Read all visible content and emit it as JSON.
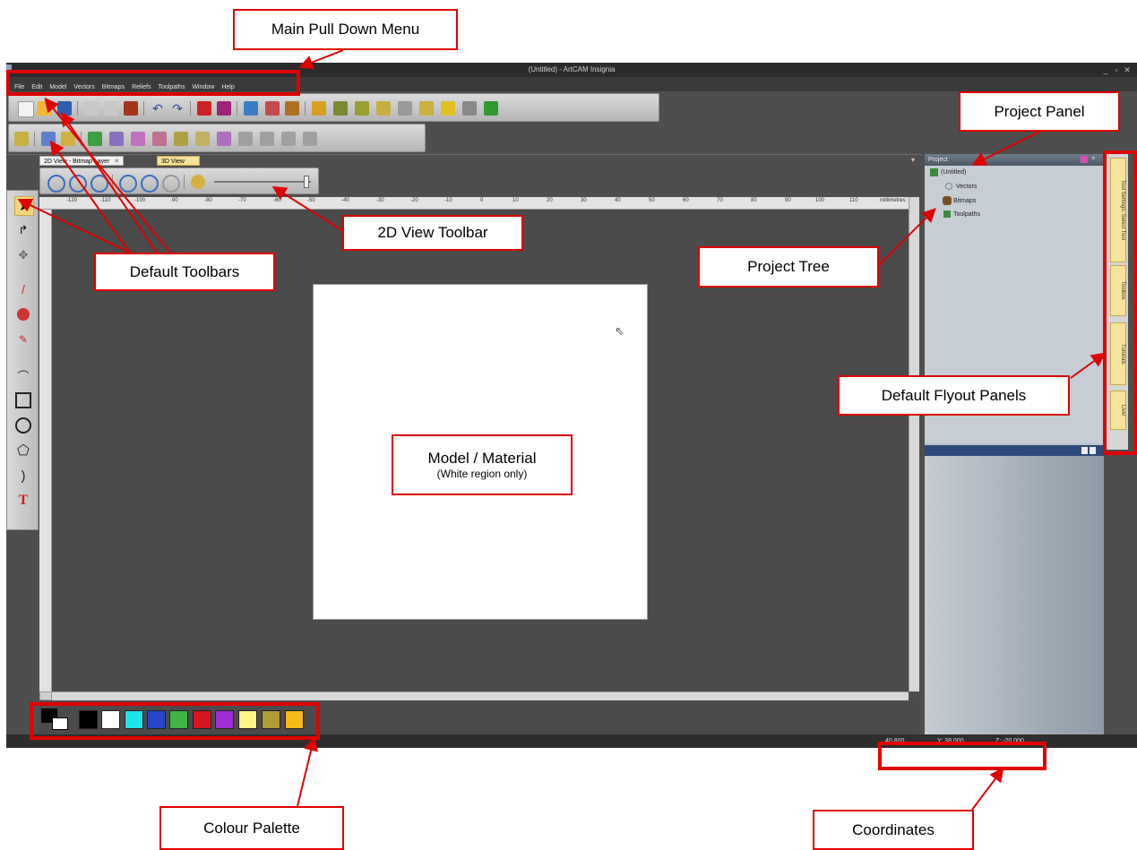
{
  "window": {
    "title": "(Untitled) - ArtCAM Insignia",
    "controls": [
      "_",
      "▫",
      "✕"
    ]
  },
  "menu": [
    "File",
    "Edit",
    "Model",
    "Vectors",
    "Bitmaps",
    "Reliefs",
    "Toolpaths",
    "Window",
    "Help"
  ],
  "view_tabs": [
    {
      "label": "2D View - Bitmap Layer",
      "close": "✕"
    },
    {
      "label": "3D View"
    }
  ],
  "ruler": {
    "ticks": [
      "-120",
      "-110",
      "-100",
      "-90",
      "-80",
      "-70",
      "-60",
      "-50",
      "-40",
      "-30",
      "-20",
      "-10",
      "0",
      "10",
      "20",
      "30",
      "40",
      "50",
      "60",
      "70",
      "80",
      "90",
      "100",
      "110"
    ],
    "unit": "millimetres"
  },
  "project": {
    "title": "Project",
    "root": "(Untitled)",
    "items": [
      "Vectors",
      "Bitmaps",
      "Toolpaths"
    ]
  },
  "flyouts": [
    "Tool Settings: Select Tool",
    "Toolbox",
    "Tutorials",
    "Live!"
  ],
  "palette": [
    "#000000",
    "#ffffff",
    "#1fe3e8",
    "#2b44c9",
    "#3fb548",
    "#d8161f",
    "#9e2ed6",
    "#fff784",
    "#b19c38",
    "#f7b81a"
  ],
  "coordinates": {
    "x": "40.800",
    "y": "Y: 38.000",
    "z": "Z: -20.000"
  },
  "callouts": {
    "main_menu": "Main Pull Down Menu",
    "project_panel": "Project Panel",
    "view_toolbar": "2D View Toolbar",
    "default_toolbars": "Default Toolbars",
    "project_tree": "Project Tree",
    "flyout_panels": "Default Flyout Panels",
    "model_material": "Model / Material",
    "model_material_note": "(White region only)",
    "colour_palette": "Colour Palette",
    "coordinates": "Coordinates"
  },
  "colors": {
    "highlight": "#e00000",
    "app_bg": "#4e4e4e",
    "material": "#ffffff"
  }
}
